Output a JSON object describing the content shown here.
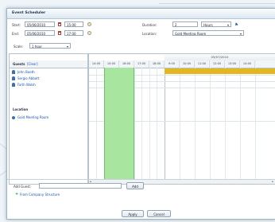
{
  "dialog": {
    "title": "Event Scheduler"
  },
  "form": {
    "start_label": "Start:",
    "start_date": "05/06/2010",
    "start_time": "15:00",
    "end_label": "End:",
    "end_date": "05/06/2010",
    "end_time": "17:00",
    "duration_label": "Duration:",
    "duration_value": "2",
    "duration_unit": "Hours",
    "location_label": "Location:",
    "location_value": "Gold Meeting Room",
    "scale_label": "Scale:",
    "scale_value": "1 hour"
  },
  "scheduler": {
    "date_header": "05/07/2010",
    "times": [
      "14:00",
      "15:00",
      "16:00",
      "17:00",
      "18:00",
      "9:00",
      "10:00",
      "11:00",
      "12:00",
      "13:00",
      "14:00"
    ],
    "guests_label": "Guests",
    "clear_link": "[Clear]",
    "guests": [
      "John Booth",
      "Sergio Abbott",
      "Faith Walsh"
    ],
    "location_section": "Location",
    "location_row": "Gold Meeting Room",
    "colors": {
      "selection": "#a8e6a0",
      "busy": "#e3b624"
    }
  },
  "footer": {
    "add_guest_label": "Add Guest:",
    "add_button": "Add",
    "from_structure": "From Company Structure",
    "apply_button": "Apply",
    "cancel_button": "Cancel"
  }
}
